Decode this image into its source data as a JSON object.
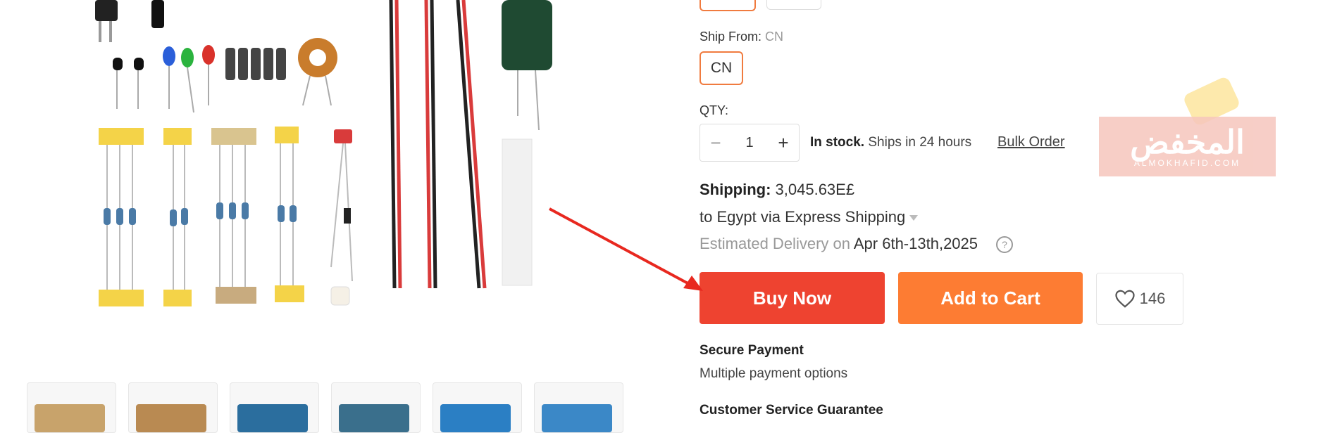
{
  "ship_from": {
    "label": "Ship From:",
    "value": "CN",
    "option": "CN"
  },
  "qty": {
    "label": "QTY:",
    "value": "1",
    "minus": "−",
    "plus": "+"
  },
  "stock": {
    "bold": "In stock.",
    "rest": " Ships in 24 hours"
  },
  "bulk_order": "Bulk Order",
  "shipping": {
    "label": "Shipping:",
    "value": " 3,045.63E£",
    "to": "to Egypt via Express Shipping"
  },
  "delivery": {
    "label": "Estimated Delivery on ",
    "date": "Apr 6th-13th,2025",
    "help": "?"
  },
  "buttons": {
    "buy_now": "Buy Now",
    "add_to_cart": "Add to Cart",
    "wishlist_count": "146"
  },
  "secure_payment": {
    "title": "Secure Payment",
    "sub": "Multiple payment options"
  },
  "customer_service": "Customer Service Guarantee",
  "watermark": {
    "arabic": "المخفض",
    "latin": "ALMOKHAFID.COM"
  },
  "colors": {
    "buy": "#ee4330",
    "cart": "#fd7c33",
    "selected_border": "#f07b3f",
    "arrow": "#e8281f"
  },
  "icons": {
    "heart": "heart-icon",
    "help": "question-circle-icon",
    "caret": "caret-down-icon"
  }
}
